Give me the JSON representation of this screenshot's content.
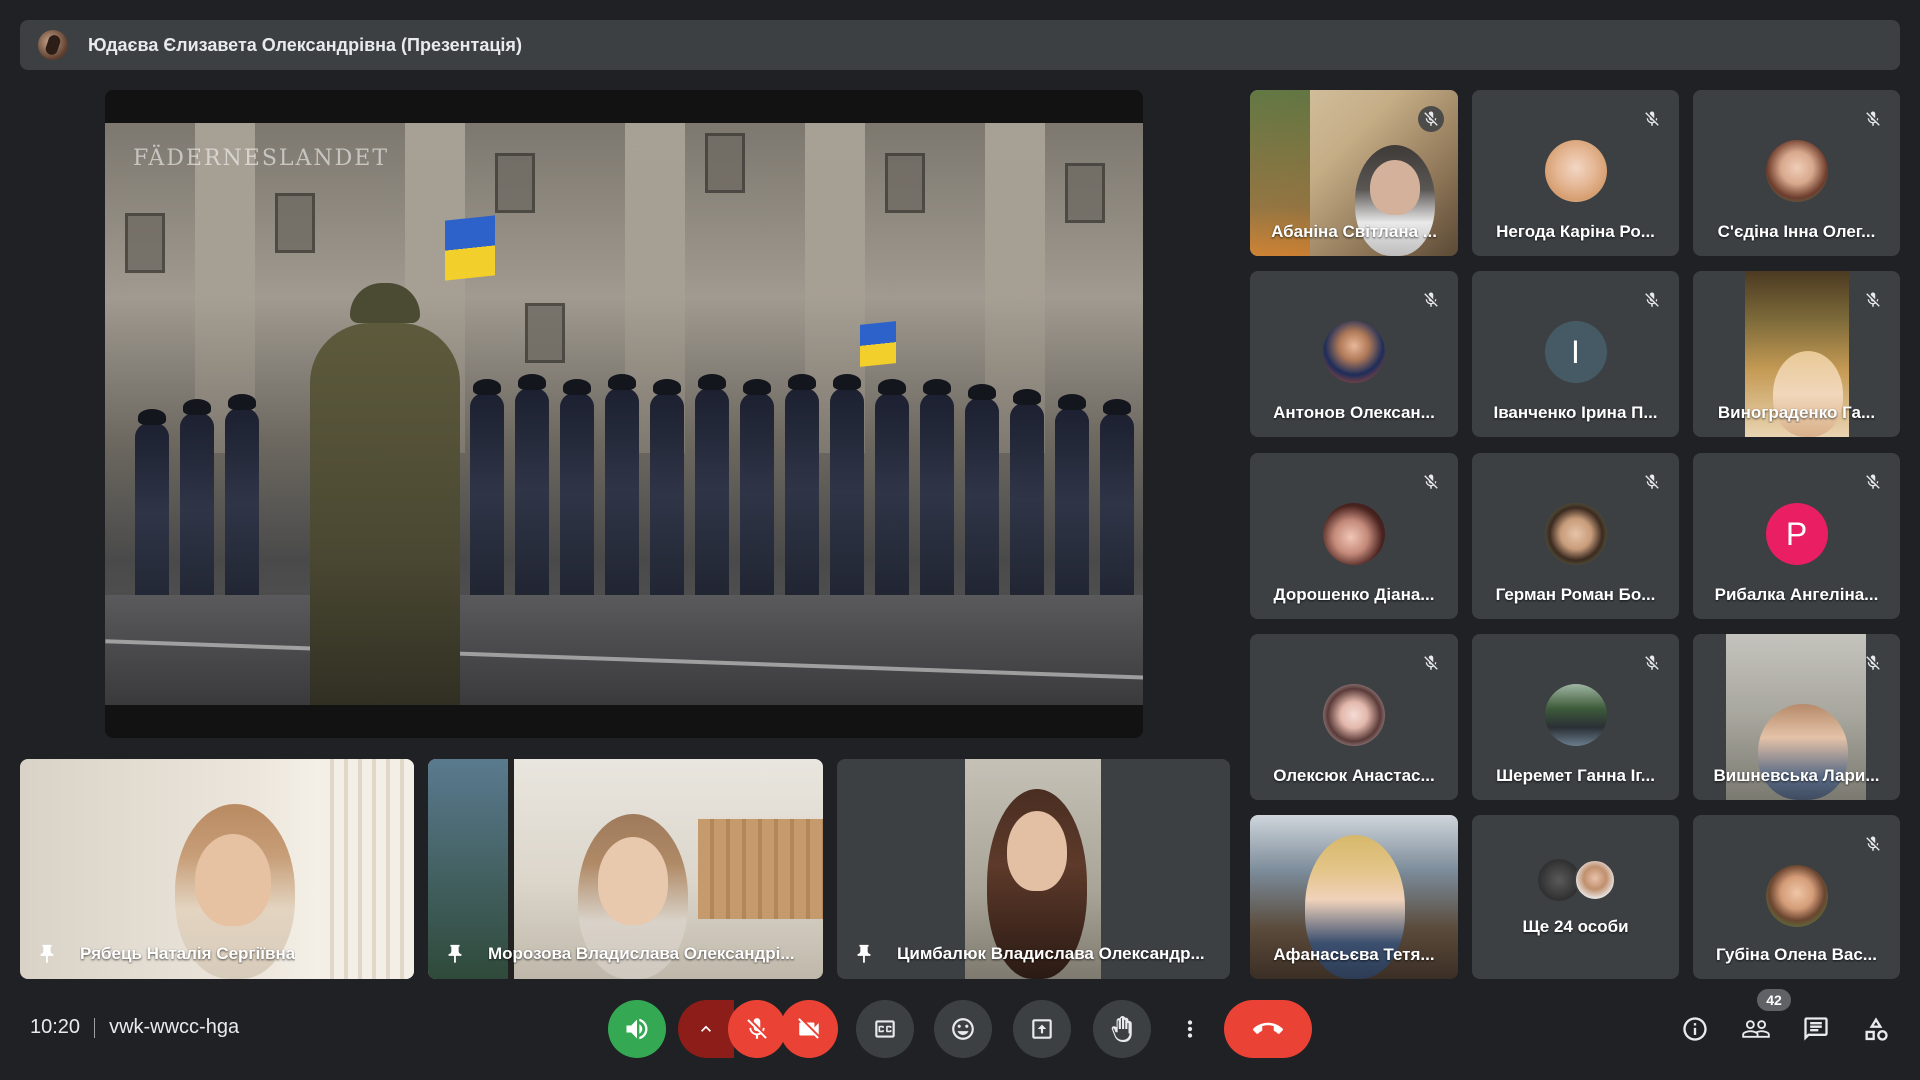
{
  "header": {
    "presenter_title": "Юдаєва Єлизавета Олександрівна (Презентація)"
  },
  "presentation": {
    "watermark": "FÄDERNESLANDET"
  },
  "bottom_tiles": [
    {
      "name": "Рябець Наталія Сергіївна"
    },
    {
      "name": "Морозова Владислава Олександрі..."
    },
    {
      "name": "Цимбалюк Владислава Олександр..."
    }
  ],
  "grid_tiles": [
    {
      "name": "Абаніна Світлана ...",
      "muted": true
    },
    {
      "name": "Негода Каріна Ро...",
      "muted": true
    },
    {
      "name": "С'єдіна Інна Олег...",
      "muted": true
    },
    {
      "name": "Антонов Олексан...",
      "muted": true
    },
    {
      "name": "Іванченко Ірина П...",
      "muted": true,
      "letter": "І",
      "letter_color": "#455a64"
    },
    {
      "name": "Винограденко Га...",
      "muted": true
    },
    {
      "name": "Дорошенко Діана...",
      "muted": true
    },
    {
      "name": "Герман Роман Бо...",
      "muted": true
    },
    {
      "name": "Рибалка Ангеліна...",
      "muted": true,
      "letter": "Р",
      "letter_color": "#e91e63"
    },
    {
      "name": "Олексюк Анастас...",
      "muted": true
    },
    {
      "name": "Шеремет Ганна Іг...",
      "muted": true
    },
    {
      "name": "Вишневська Лари...",
      "muted": true
    },
    {
      "name": "Афанасьєва Тетя...",
      "muted": false
    },
    {
      "name": "Ще 24 особи",
      "muted": false
    },
    {
      "name": "Губіна Олена Вас...",
      "muted": true
    }
  ],
  "meeting": {
    "time": "10:20",
    "code": "vwk-wwcc-hga",
    "participant_count": "42"
  },
  "colors": {
    "background": "#202124",
    "tile": "#3c4043",
    "danger": "#ea4335",
    "speaker_active": "#34a853"
  },
  "icons": {
    "speaker": "volume-icon",
    "mic": "mic-off-icon",
    "camera": "camera-off-icon",
    "captions": "captions-icon",
    "emoji": "emoji-icon",
    "present": "present-icon",
    "hand": "raise-hand-icon",
    "more": "more-vert-icon",
    "hangup": "call-end-icon",
    "info": "info-icon",
    "people": "people-icon",
    "chat": "chat-icon",
    "activities": "activities-icon"
  }
}
